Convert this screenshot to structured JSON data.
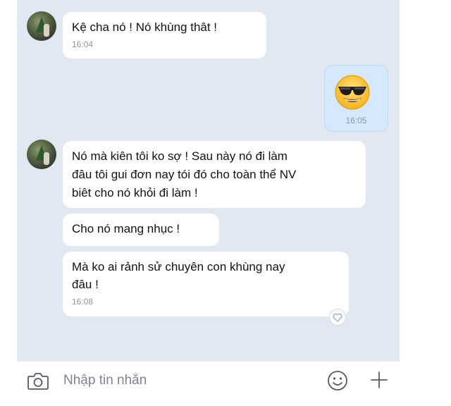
{
  "messages": [
    {
      "sender": "other",
      "text": "Kệ cha nó ! Nó khùng thât !",
      "time": "16:04"
    },
    {
      "sender": "me",
      "content": "sunglasses-emoji",
      "time": "16:05"
    },
    {
      "sender": "other",
      "text": "Nó mà kiên tôi ko sợ ! Sau này nó đi làm\nđâu tôi gui đơn nay tói đó cho toàn thể NV\nbiêt cho nó khỏi đi làm !"
    },
    {
      "sender": "other",
      "text": "Cho nó mang nhục !"
    },
    {
      "sender": "other",
      "text": "Mà ko ai rảnh sử chuyên con khùng nay\nđâu !",
      "time": "16:08"
    }
  ],
  "composer": {
    "placeholder": "Nhập tin nhắn"
  },
  "icons": {
    "camera": "camera-icon",
    "emoji": "smiley-icon",
    "add": "plus-icon",
    "reaction": "heart-icon"
  },
  "colors": {
    "chat_bg": "#e2e8f1",
    "my_bubble": "#d6e8fb",
    "their_bubble": "#ffffff",
    "time_text": "#8d96a3"
  }
}
